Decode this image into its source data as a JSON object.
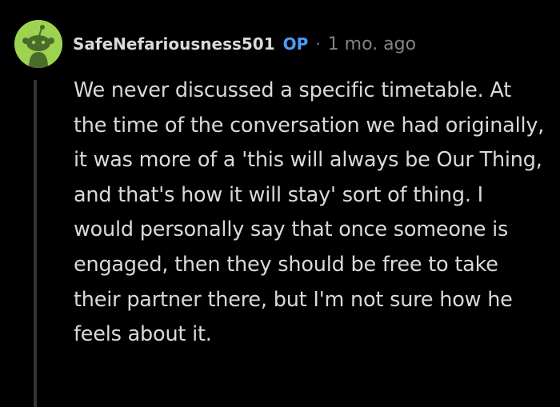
{
  "comment": {
    "author": "SafeNefariousness501",
    "op_label": "OP",
    "separator": "·",
    "timestamp": "1 mo. ago",
    "avatar_icon": "snoo-avatar-icon",
    "avatar_color": "#9ed352",
    "badge_color": "#4a9eff",
    "body": "We never discussed a specific timetable. At the time of the conversation we had originally, it was more of a 'this will always be Our Thing, and that's how it will stay' sort of thing. I would personally say that once someone is engaged, then they should be free to take their partner there, but I'm not sure how he feels about it."
  }
}
